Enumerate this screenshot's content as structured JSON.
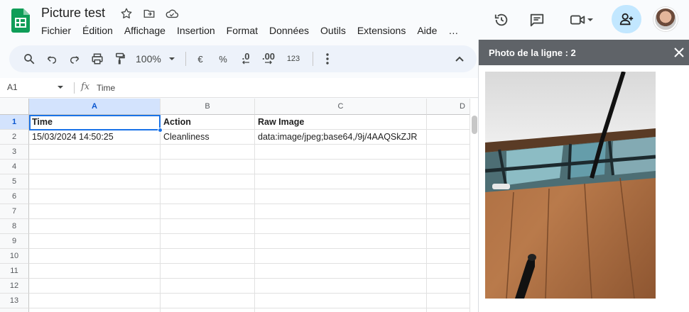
{
  "app": {
    "doc_title": "Picture test",
    "logo_icon": "google-sheets-logo",
    "menu": [
      "Fichier",
      "Édition",
      "Affichage",
      "Insertion",
      "Format",
      "Données",
      "Outils",
      "Extensions",
      "Aide",
      "…"
    ]
  },
  "toolbar": {
    "zoom": "100%",
    "currency": "€",
    "percent": "%",
    "decrease_decimals": ".0",
    "increase_decimals": ".00",
    "number_format": "123"
  },
  "formula_bar": {
    "cell_ref": "A1",
    "fx_label": "fx",
    "value": "Time"
  },
  "sheet": {
    "columns": [
      "A",
      "B",
      "C",
      "D"
    ],
    "row_numbers": [
      "1",
      "2",
      "3",
      "4",
      "5",
      "6",
      "7",
      "8",
      "9",
      "10",
      "11",
      "12",
      "13"
    ],
    "header_row": [
      "Time",
      "Action",
      "Raw Image"
    ],
    "rows": [
      [
        "15/03/2024 14:50:25",
        "Cleanliness",
        "data:image/jpeg;base64,/9j/4AAQSkZJR"
      ]
    ],
    "selected_cell": "A1"
  },
  "panel": {
    "title": "Photo de la ligne : 2",
    "image_subject": "floor-photo"
  },
  "colors": {
    "accent": "#1a73e8",
    "selected_header": "#d3e3fd",
    "share_button": "#c2e7ff",
    "panel_header": "#5f6368",
    "sheets_green": "#188038"
  }
}
